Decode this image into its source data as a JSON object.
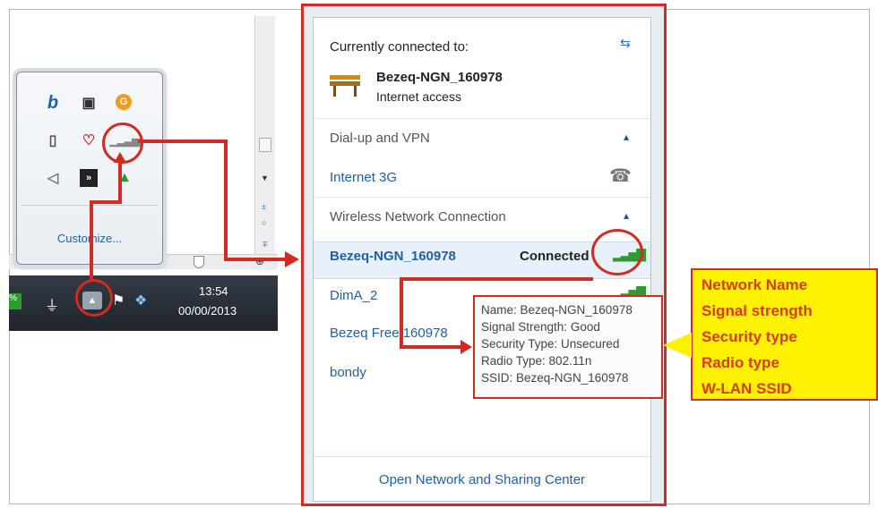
{
  "tray": {
    "customize_label": "Customize...",
    "icons": [
      "b-icon",
      "monitor-icon",
      "orange-circle-icon",
      "usb-icon",
      "heart-icon",
      "signal-bars-icon",
      "speaker-icon",
      "black-box-icon",
      "green-up-icon"
    ]
  },
  "taskbar": {
    "time": "13:54",
    "date": "00/00/2013"
  },
  "panel": {
    "currently_connected_label": "Currently connected to:",
    "current_network": "Bezeq-NGN_160978",
    "current_status": "Internet access",
    "dialup_section": "Dial-up and VPN",
    "internet3g": "Internet 3G",
    "wireless_section": "Wireless Network Connection",
    "networks": [
      {
        "name": "Bezeq-NGN_160978",
        "status": "Connected"
      },
      {
        "name": "DimA_2"
      },
      {
        "name": "Bezeq Free 160978"
      },
      {
        "name": "bondy"
      }
    ],
    "open_center": "Open Network and Sharing Center"
  },
  "tooltip": {
    "name": "Name: Bezeq-NGN_160978",
    "signal": "Signal Strength: Good",
    "security": "Security Type: Unsecured",
    "radio": "Radio Type: 802.11n",
    "ssid": "SSID: Bezeq-NGN_160978"
  },
  "legend": [
    "Network Name",
    "Signal strength",
    "Security type",
    "Radio type",
    "W-LAN SSID"
  ],
  "colors": {
    "accent_red": "#d42a22",
    "link_blue": "#1f5fa8",
    "legend_yellow": "#fff200",
    "legend_text": "#d93a16"
  }
}
